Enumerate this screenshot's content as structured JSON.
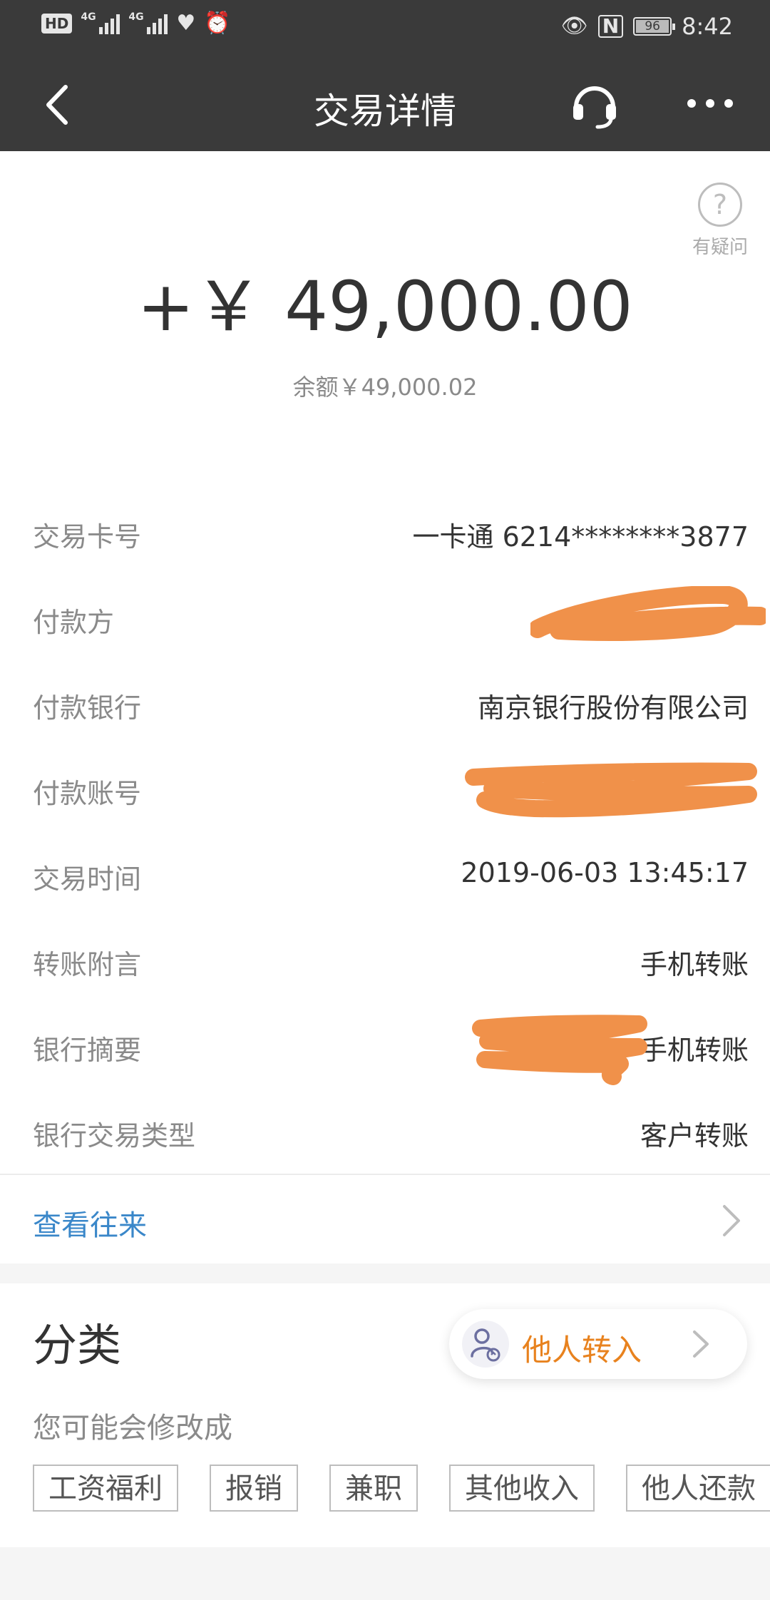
{
  "status_bar": {
    "hd": "HD",
    "net1": "4G",
    "net2": "4G",
    "battery": "96",
    "time": "8:42"
  },
  "nav": {
    "title": "交易详情"
  },
  "help": {
    "label": "有疑问"
  },
  "amount": "+￥ 49,000.00",
  "balance": "余额￥49,000.02",
  "details": [
    {
      "label": "交易卡号",
      "value": "一卡通 6214********3877"
    },
    {
      "label": "付款方",
      "value": ""
    },
    {
      "label": "付款银行",
      "value": "南京银行股份有限公司"
    },
    {
      "label": "付款账号",
      "value": ""
    },
    {
      "label": "交易时间",
      "value": "2019-06-03 13:45:17"
    },
    {
      "label": "转账附言",
      "value": "手机转账"
    },
    {
      "label": "银行摘要",
      "value": "手机转账"
    },
    {
      "label": "银行交易类型",
      "value": "客户转账"
    }
  ],
  "contacts_link": "查看往来",
  "category": {
    "title": "分类",
    "current": "他人转入",
    "hint": "您可能会修改成",
    "options": [
      "工资福利",
      "报销",
      "兼职",
      "其他收入",
      "他人还款"
    ]
  },
  "colors": {
    "header_bg": "#3a3a3a",
    "link_blue": "#3a87c9",
    "accent_orange": "#e8821e",
    "redaction": "#f0914a"
  }
}
